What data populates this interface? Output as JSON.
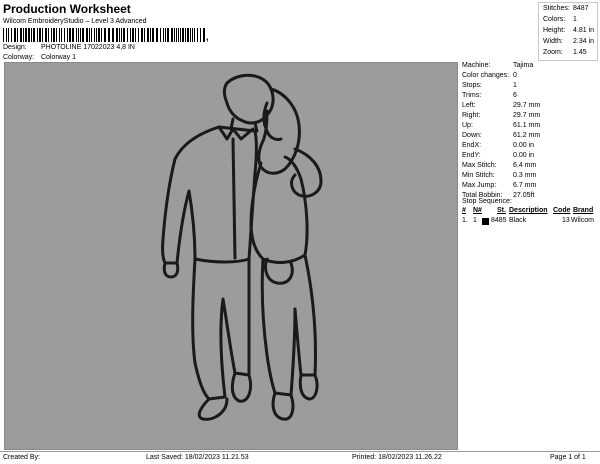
{
  "header": {
    "title": "Production Worksheet",
    "subtitle": "Wilcom EmbroideryStudio – Level 3 Advanced",
    "barcode_suffix": ",",
    "design_label": "Design:",
    "design_value": "PHOTOLINE 17022023 4,8 IN",
    "colorway_label": "Colorway:",
    "colorway_value": "Colorway 1"
  },
  "summary": [
    {
      "label": "Stitches:",
      "value": "8487"
    },
    {
      "label": "Colors:",
      "value": "1"
    },
    {
      "label": "Height:",
      "value": "4.81 in"
    },
    {
      "label": "Width:",
      "value": "2.34 in"
    },
    {
      "label": "Zoom:",
      "value": "1.45"
    }
  ],
  "machine_info": [
    {
      "label": "Machine:",
      "value": "Tajima"
    },
    {
      "label": "Color changes:",
      "value": "0"
    },
    {
      "label": "Stops:",
      "value": "1"
    },
    {
      "label": "Trims:",
      "value": "6"
    },
    {
      "label": "Left:",
      "value": "29.7 mm"
    },
    {
      "label": "Right:",
      "value": "29.7 mm"
    },
    {
      "label": "Up:",
      "value": "61.1 mm"
    },
    {
      "label": "Down:",
      "value": "61.2 mm"
    },
    {
      "label": "EndX:",
      "value": "0.00 in"
    },
    {
      "label": "EndY:",
      "value": "0.00 in"
    },
    {
      "label": "Max Stitch:",
      "value": "6.4 mm"
    },
    {
      "label": "Min Stitch:",
      "value": "0.3 mm"
    },
    {
      "label": "Max Jump:",
      "value": "6.7 mm"
    },
    {
      "label": "Total Bobbin:",
      "value": "27.05ft"
    }
  ],
  "stop_sequence": {
    "title": "Stop Sequence:",
    "columns": [
      "#",
      "N#",
      "St.",
      "Description",
      "Code",
      "Brand"
    ],
    "rows": [
      {
        "num": "1.",
        "n": "1",
        "stitches": "8485",
        "description": "Black",
        "code": "13",
        "brand": "Wilcom",
        "color": "#000000"
      }
    ]
  },
  "footer": {
    "created": "Created By:",
    "last_saved": "Last Saved: 18/02/2023 11.21.53",
    "printed": "Printed: 18/02/2023 11.26.22",
    "page": "Page 1 of 1"
  },
  "colors": {
    "canvas_bg": "#9c9c9c",
    "stitch_line": "#1a1a1a"
  }
}
